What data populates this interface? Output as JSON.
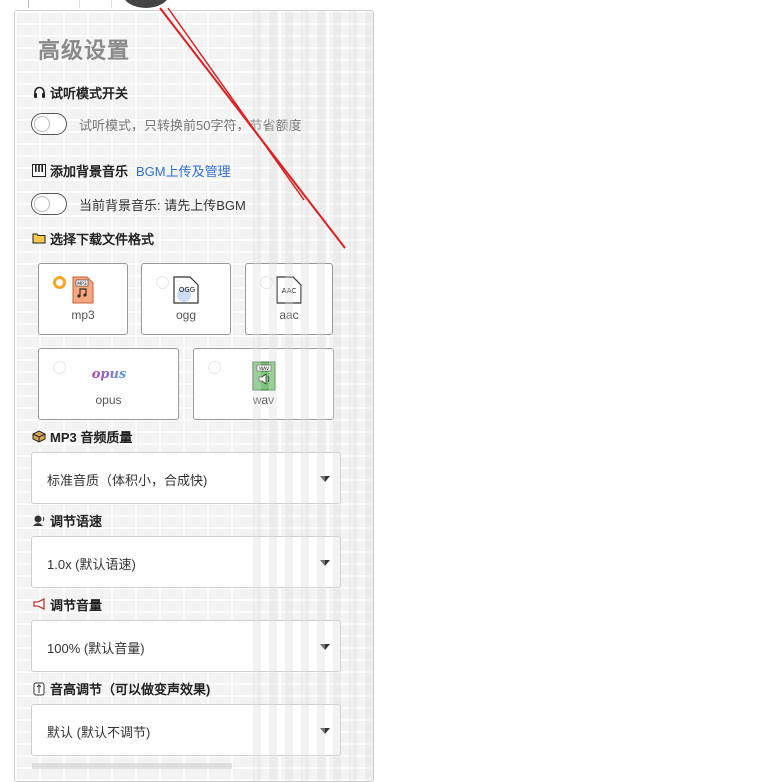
{
  "panel": {
    "title": "高级设置"
  },
  "preview": {
    "header": "试听模式开关",
    "toggle_text": "试听模式，只转换前50字符，节省额度",
    "enabled": false
  },
  "bgm": {
    "header": "添加背景音乐",
    "link": "BGM上传及管理",
    "toggle_text": "当前背景音乐: 请先上传BGM",
    "enabled": false
  },
  "format": {
    "header": "选择下载文件格式",
    "selected": "mp3",
    "options": [
      {
        "label": "mp3",
        "icon_text": "MP3"
      },
      {
        "label": "ogg",
        "icon_text": "OGG"
      },
      {
        "label": "aac",
        "icon_text": "AAC"
      },
      {
        "label": "opus",
        "icon_text": "opus"
      },
      {
        "label": "wav",
        "icon_text": "WAV"
      }
    ]
  },
  "quality": {
    "header": "MP3 音频质量",
    "value": "标准音质（体积小，合成快)"
  },
  "speed": {
    "header": "调节语速",
    "value": "1.0x (默认语速)"
  },
  "volume": {
    "header": "调节音量",
    "value": "100% (默认音量)"
  },
  "pitch": {
    "header": "音高调节（可以做变声效果)",
    "value": "默认 (默认不调节)"
  },
  "colors": {
    "accent": "#f5a623",
    "link": "#2f6fd0",
    "annotation": "#e02020"
  }
}
